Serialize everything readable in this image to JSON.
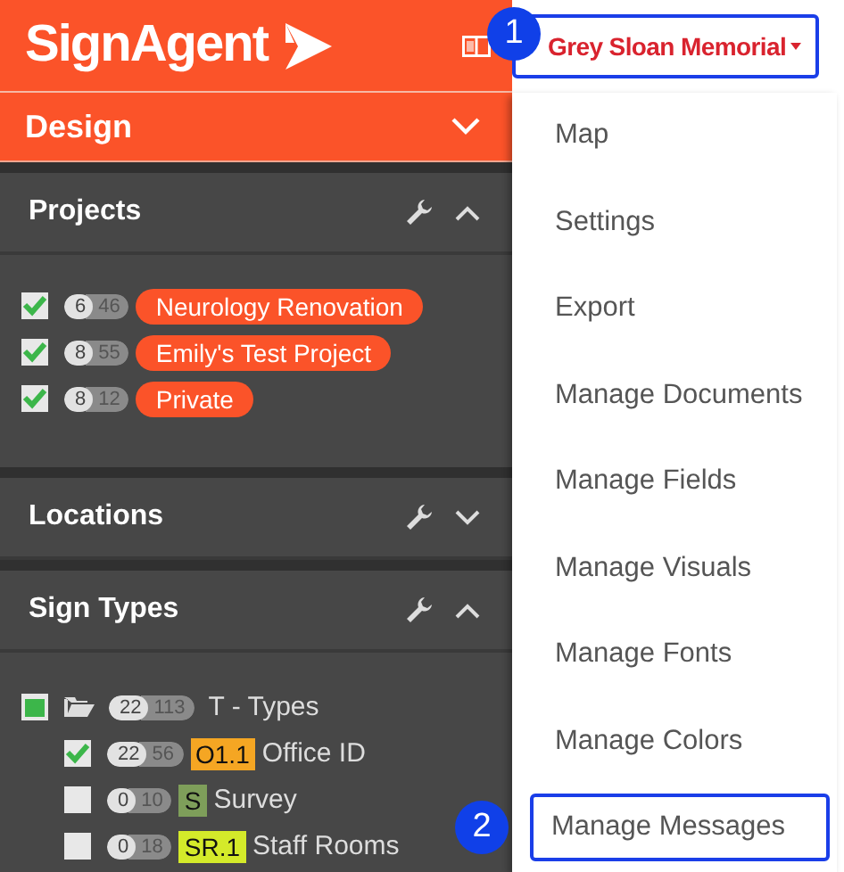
{
  "brand": {
    "name": "SignAgent"
  },
  "account": {
    "label": "Grey Sloan Memorial",
    "highlighted": true,
    "callout": "1"
  },
  "mode": {
    "label": "Design",
    "expanded": false
  },
  "projects": {
    "title": "Projects",
    "expanded": true,
    "items": [
      {
        "checked": true,
        "count_a": "6",
        "count_b": "46",
        "label": "Neurology Renovation"
      },
      {
        "checked": true,
        "count_a": "8",
        "count_b": "55",
        "label": "Emily's Test Project"
      },
      {
        "checked": true,
        "count_a": "8",
        "count_b": "12",
        "label": "Private"
      }
    ]
  },
  "locations": {
    "title": "Locations",
    "expanded": false
  },
  "sign_types": {
    "title": "Sign Types",
    "expanded": true,
    "tree": [
      {
        "checked": false,
        "partial": true,
        "count_a": "22",
        "count_b": "113",
        "label": "T - Types",
        "children": [
          {
            "checked": true,
            "partial": false,
            "count_a": "22",
            "count_b": "56",
            "code": "O1.1",
            "color": "#f5a623",
            "label": "Office ID"
          },
          {
            "checked": false,
            "partial": false,
            "count_a": "0",
            "count_b": "10",
            "code": "S",
            "color": "#7e9e5a",
            "label": "Survey"
          },
          {
            "checked": false,
            "partial": false,
            "count_a": "0",
            "count_b": "18",
            "code": "SR.1",
            "color": "#d4ea2a",
            "label": "Staff Rooms"
          }
        ]
      }
    ]
  },
  "menu": [
    {
      "label": "Map",
      "highlighted": false
    },
    {
      "label": "Settings",
      "highlighted": false
    },
    {
      "label": "Export",
      "highlighted": false
    },
    {
      "label": "Manage Documents",
      "highlighted": false
    },
    {
      "label": "Manage Fields",
      "highlighted": false
    },
    {
      "label": "Manage Visuals",
      "highlighted": false
    },
    {
      "label": "Manage Fonts",
      "highlighted": false
    },
    {
      "label": "Manage Colors",
      "highlighted": false
    },
    {
      "label": "Manage Messages",
      "highlighted": true,
      "callout": "2"
    }
  ]
}
